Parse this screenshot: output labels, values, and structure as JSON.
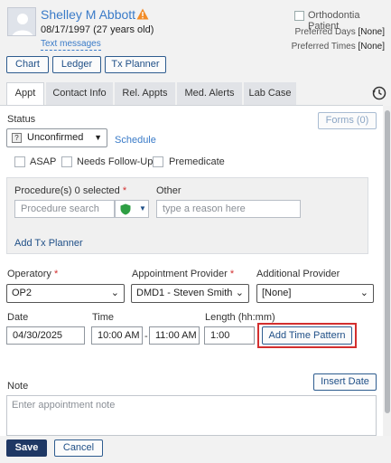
{
  "patient": {
    "name": "Shelley M Abbott",
    "dob": "08/17/1997 (27 years old)",
    "text_messages": "Text messages",
    "orthodontia_label": "Orthodontia Patient",
    "preferred_days_label": "Preferred Days",
    "preferred_days_value": "[None]",
    "preferred_times_label": "Preferred Times",
    "preferred_times_value": "[None]"
  },
  "nav_buttons": [
    "Chart",
    "Ledger",
    "Tx Planner"
  ],
  "tabs": [
    "Appt",
    "Contact Info",
    "Rel. Appts",
    "Med. Alerts",
    "Lab Case"
  ],
  "status": {
    "label": "Status",
    "value": "Unconfirmed",
    "schedule_link": "Schedule",
    "forms_button": "Forms (0)"
  },
  "flags": {
    "asap": "ASAP",
    "follow_up": "Needs Follow-Up",
    "premedicate": "Premedicate"
  },
  "procedures": {
    "label": "Procedure(s)",
    "count": "0 selected",
    "search_placeholder": "Procedure search",
    "other_label": "Other",
    "other_placeholder": "type a reason here",
    "add_tx_planner": "Add Tx Planner"
  },
  "providers": {
    "operatory_label": "Operatory",
    "operatory_value": "OP2",
    "appt_provider_label": "Appointment Provider",
    "appt_provider_value": "DMD1 - Steven Smith",
    "additional_label": "Additional Provider",
    "additional_value": "[None]"
  },
  "timing": {
    "date_label": "Date",
    "date_value": "04/30/2025",
    "time_label": "Time",
    "start_time": "10:00 AM",
    "separator": "-",
    "end_time": "11:00 AM",
    "length_label": "Length (hh:mm)",
    "length_value": "1:00",
    "add_time_pattern": "Add Time Pattern"
  },
  "note": {
    "label": "Note",
    "insert_date": "Insert Date",
    "placeholder": "Enter appointment note"
  },
  "footer": {
    "save": "Save",
    "cancel": "Cancel"
  },
  "colors": {
    "accent_blue": "#3a7bc8",
    "navy": "#1f3864",
    "warning": "#f28c28",
    "highlight": "#d32f2f"
  }
}
